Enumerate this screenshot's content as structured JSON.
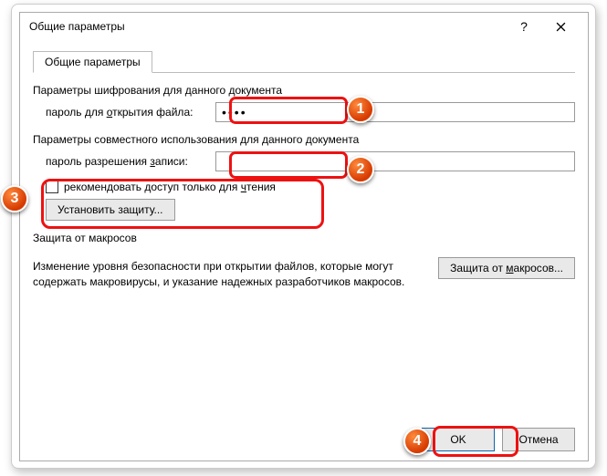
{
  "window": {
    "title": "Общие параметры"
  },
  "tab": {
    "label": "Общие параметры"
  },
  "encryption": {
    "section": "Параметры шифрования для данного документа",
    "password_open_label_pre": "пароль для ",
    "password_open_label_u": "о",
    "password_open_label_post": "ткрытия файла:",
    "password_open_value": "••••"
  },
  "sharing": {
    "section": "Параметры совместного использования для данного документа",
    "password_write_label_pre": "пароль разрешения ",
    "password_write_label_u": "з",
    "password_write_label_post": "аписи:",
    "password_write_value": ""
  },
  "readonly": {
    "label_pre": "рекомендовать доступ только для ",
    "label_u": "ч",
    "label_post": "тения"
  },
  "protect_btn": "Установить защиту...",
  "macros": {
    "section": "Защита от макросов",
    "text": "Изменение уровня безопасности при открытии файлов, которые могут содержать макровирусы, и указание надежных разработчиков макросов.",
    "button_pre": "Защита от ",
    "button_u": "м",
    "button_post": "акросов..."
  },
  "footer": {
    "ok": "OK",
    "cancel": "Отмена"
  },
  "badges": {
    "b1": "1",
    "b2": "2",
    "b3": "3",
    "b4": "4"
  }
}
